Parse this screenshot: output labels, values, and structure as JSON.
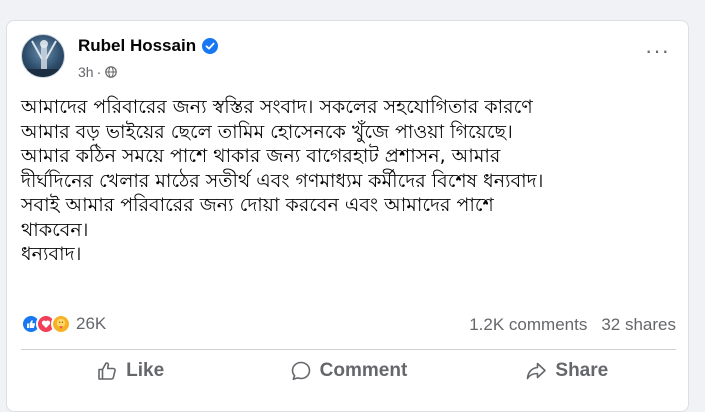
{
  "post": {
    "author": "Rubel Hossain",
    "time": "3h",
    "separator": "·",
    "more_label": "···",
    "body_lines": [
      "আমাদের পরিবারের জন্য স্বস্তির সংবাদ। সকলের সহযোগিতার কারণে",
      "আমার বড় ভাইয়ের ছেলে তামিম হোসেনকে খুঁজে পাওয়া গিয়েছে।",
      "আমার কঠিন সময়ে পাশে থাকার জন্য বাগেরহাট প্রশাসন, আমার",
      "দীর্ঘদিনের খেলার মাঠের সতীর্থ এবং গণমাধ্যম কর্মীদের বিশেষ ধন্যবাদ।",
      "সবাই আমার পরিবারের জন্য দোয়া করবেন এবং আমাদের পাশে",
      "থাকবেন।",
      "ধন্যবাদ।"
    ]
  },
  "stats": {
    "reaction_count": "26K",
    "comments": "1.2K comments",
    "shares": "32 shares"
  },
  "actions": {
    "like": "Like",
    "comment": "Comment",
    "share": "Share"
  },
  "colors": {
    "primary": "#1877f2",
    "secondary_text": "#65676b",
    "love": "#f33e58",
    "care": "#f7b125"
  }
}
